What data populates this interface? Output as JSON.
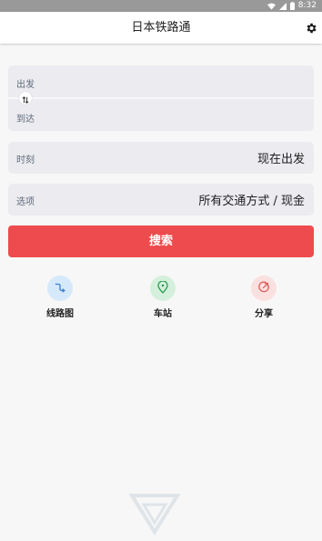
{
  "status_bar": {
    "time": "8:32",
    "icons": [
      "wifi-icon",
      "signal-icon",
      "battery-icon"
    ]
  },
  "app_bar": {
    "title": "日本铁路通",
    "settings_icon": "gear-icon"
  },
  "route": {
    "from_label": "出发",
    "to_label": "到达",
    "swap_icon": "swap-vertical-icon"
  },
  "time_row": {
    "label": "时刻",
    "value": "现在出发"
  },
  "option_row": {
    "label": "选项",
    "value": "所有交通方式 / 现金"
  },
  "search_button": {
    "label": "搜索"
  },
  "shortcuts": [
    {
      "label": "线路图",
      "icon": "route-map-icon",
      "color": "#d6e9fb"
    },
    {
      "label": "车站",
      "icon": "station-pin-icon",
      "color": "#d4f0dc"
    },
    {
      "label": "分享",
      "icon": "share-icon",
      "color": "#fbe0e0"
    }
  ],
  "colors": {
    "accent": "#ee4b4e",
    "card_bg": "#ebebf0",
    "status_bar": "#999999"
  }
}
